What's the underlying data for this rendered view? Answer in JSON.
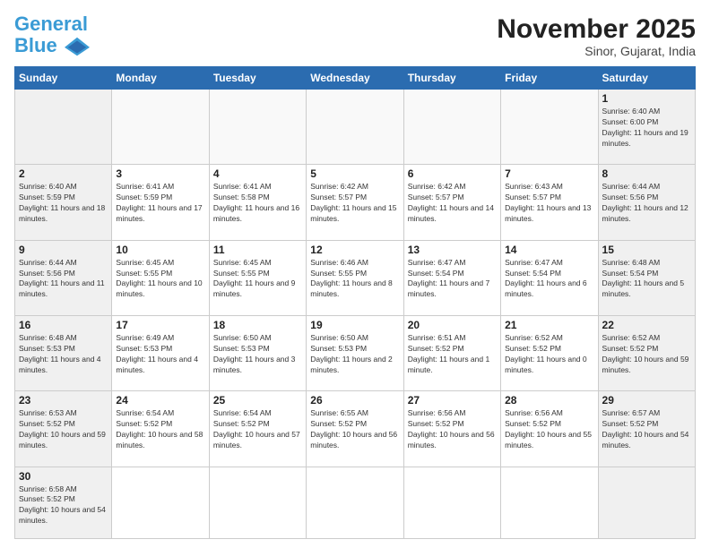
{
  "header": {
    "logo_general": "General",
    "logo_blue": "Blue",
    "month_title": "November 2025",
    "location": "Sinor, Gujarat, India"
  },
  "weekdays": [
    "Sunday",
    "Monday",
    "Tuesday",
    "Wednesday",
    "Thursday",
    "Friday",
    "Saturday"
  ],
  "days": [
    {
      "date": null,
      "sunrise": null,
      "sunset": null,
      "daylight": null
    },
    {
      "date": null,
      "sunrise": null,
      "sunset": null,
      "daylight": null
    },
    {
      "date": null,
      "sunrise": null,
      "sunset": null,
      "daylight": null
    },
    {
      "date": null,
      "sunrise": null,
      "sunset": null,
      "daylight": null
    },
    {
      "date": null,
      "sunrise": null,
      "sunset": null,
      "daylight": null
    },
    {
      "date": null,
      "sunrise": null,
      "sunset": null,
      "daylight": null
    },
    {
      "date": "1",
      "sunrise": "6:40 AM",
      "sunset": "6:00 PM",
      "daylight": "11 hours and 19 minutes."
    },
    {
      "date": "2",
      "sunrise": "6:40 AM",
      "sunset": "5:59 PM",
      "daylight": "11 hours and 18 minutes."
    },
    {
      "date": "3",
      "sunrise": "6:41 AM",
      "sunset": "5:59 PM",
      "daylight": "11 hours and 17 minutes."
    },
    {
      "date": "4",
      "sunrise": "6:41 AM",
      "sunset": "5:58 PM",
      "daylight": "11 hours and 16 minutes."
    },
    {
      "date": "5",
      "sunrise": "6:42 AM",
      "sunset": "5:57 PM",
      "daylight": "11 hours and 15 minutes."
    },
    {
      "date": "6",
      "sunrise": "6:42 AM",
      "sunset": "5:57 PM",
      "daylight": "11 hours and 14 minutes."
    },
    {
      "date": "7",
      "sunrise": "6:43 AM",
      "sunset": "5:57 PM",
      "daylight": "11 hours and 13 minutes."
    },
    {
      "date": "8",
      "sunrise": "6:44 AM",
      "sunset": "5:56 PM",
      "daylight": "11 hours and 12 minutes."
    },
    {
      "date": "9",
      "sunrise": "6:44 AM",
      "sunset": "5:56 PM",
      "daylight": "11 hours and 11 minutes."
    },
    {
      "date": "10",
      "sunrise": "6:45 AM",
      "sunset": "5:55 PM",
      "daylight": "11 hours and 10 minutes."
    },
    {
      "date": "11",
      "sunrise": "6:45 AM",
      "sunset": "5:55 PM",
      "daylight": "11 hours and 9 minutes."
    },
    {
      "date": "12",
      "sunrise": "6:46 AM",
      "sunset": "5:55 PM",
      "daylight": "11 hours and 8 minutes."
    },
    {
      "date": "13",
      "sunrise": "6:47 AM",
      "sunset": "5:54 PM",
      "daylight": "11 hours and 7 minutes."
    },
    {
      "date": "14",
      "sunrise": "6:47 AM",
      "sunset": "5:54 PM",
      "daylight": "11 hours and 6 minutes."
    },
    {
      "date": "15",
      "sunrise": "6:48 AM",
      "sunset": "5:54 PM",
      "daylight": "11 hours and 5 minutes."
    },
    {
      "date": "16",
      "sunrise": "6:48 AM",
      "sunset": "5:53 PM",
      "daylight": "11 hours and 4 minutes."
    },
    {
      "date": "17",
      "sunrise": "6:49 AM",
      "sunset": "5:53 PM",
      "daylight": "11 hours and 4 minutes."
    },
    {
      "date": "18",
      "sunrise": "6:50 AM",
      "sunset": "5:53 PM",
      "daylight": "11 hours and 3 minutes."
    },
    {
      "date": "19",
      "sunrise": "6:50 AM",
      "sunset": "5:53 PM",
      "daylight": "11 hours and 2 minutes."
    },
    {
      "date": "20",
      "sunrise": "6:51 AM",
      "sunset": "5:52 PM",
      "daylight": "11 hours and 1 minute."
    },
    {
      "date": "21",
      "sunrise": "6:52 AM",
      "sunset": "5:52 PM",
      "daylight": "11 hours and 0 minutes."
    },
    {
      "date": "22",
      "sunrise": "6:52 AM",
      "sunset": "5:52 PM",
      "daylight": "10 hours and 59 minutes."
    },
    {
      "date": "23",
      "sunrise": "6:53 AM",
      "sunset": "5:52 PM",
      "daylight": "10 hours and 59 minutes."
    },
    {
      "date": "24",
      "sunrise": "6:54 AM",
      "sunset": "5:52 PM",
      "daylight": "10 hours and 58 minutes."
    },
    {
      "date": "25",
      "sunrise": "6:54 AM",
      "sunset": "5:52 PM",
      "daylight": "10 hours and 57 minutes."
    },
    {
      "date": "26",
      "sunrise": "6:55 AM",
      "sunset": "5:52 PM",
      "daylight": "10 hours and 56 minutes."
    },
    {
      "date": "27",
      "sunrise": "6:56 AM",
      "sunset": "5:52 PM",
      "daylight": "10 hours and 56 minutes."
    },
    {
      "date": "28",
      "sunrise": "6:56 AM",
      "sunset": "5:52 PM",
      "daylight": "10 hours and 55 minutes."
    },
    {
      "date": "29",
      "sunrise": "6:57 AM",
      "sunset": "5:52 PM",
      "daylight": "10 hours and 54 minutes."
    },
    {
      "date": "30",
      "sunrise": "6:58 AM",
      "sunset": "5:52 PM",
      "daylight": "10 hours and 54 minutes."
    }
  ]
}
